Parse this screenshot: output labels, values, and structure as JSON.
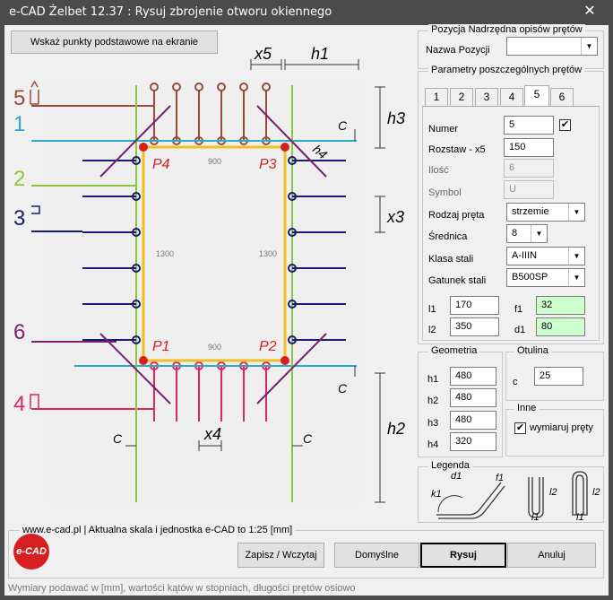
{
  "window": {
    "title": "e-CAD Żelbet 12.37 : Rysuj zbrojenie otworu okiennego",
    "close_glyph": "✕"
  },
  "toolbar": {
    "points_button": "Wskaż punkty podstawowe na ekranie"
  },
  "drawing": {
    "dim_labels": {
      "x5": "x5",
      "h1": "h1",
      "h3": "h3",
      "h4": "h4",
      "c": "C",
      "x3": "x3",
      "x4": "x4",
      "h2": "h2"
    },
    "legend_labels": {
      "b5": "5",
      "b1": "1",
      "b2": "2",
      "b3": "3",
      "b6": "6",
      "b4": "4"
    },
    "points": {
      "p1": "P1",
      "p2": "P2",
      "p3": "P3",
      "p4": "P4"
    },
    "values": {
      "width_top": "900",
      "width_bottom": "900",
      "height_left": "1300",
      "height_right": "1300"
    },
    "colors": {
      "bar5": "#9b4a3a",
      "bar1": "#27a9c9",
      "bar2": "#8cc63f",
      "bar3": "#1a1a6e",
      "bar6": "#7a1f6e",
      "bar4": "#e0245e",
      "frame": "#f0c020",
      "point": "#d62020"
    }
  },
  "parent": {
    "group_title": "Pozycja Nadrzędna opisów prętów",
    "name_label": "Nazwa Pozycji",
    "name_value": ""
  },
  "params": {
    "group_title": "Parametry poszczególnych prętów",
    "tabs": [
      "1",
      "2",
      "3",
      "4",
      "5",
      "6"
    ],
    "active_tab": "5",
    "numer_label": "Numer",
    "numer_value": "5",
    "rozstaw_label": "Rozstaw - x5",
    "rozstaw_value": "150",
    "ilosc_label": "Ilość",
    "ilosc_value": "6",
    "symbol_label": "Symbol",
    "symbol_value": "U",
    "rodzaj_label": "Rodzaj pręta",
    "rodzaj_value": "strzemie",
    "srednica_label": "Średnica",
    "srednica_value": "8",
    "klasa_label": "Klasa stali",
    "klasa_value": "A-IIIN",
    "gatunek_label": "Gatunek stali",
    "gatunek_value": "B500SP",
    "l1_label": "l1",
    "l1_value": "170",
    "l2_label": "l2",
    "l2_value": "350",
    "f1_label": "f1",
    "f1_value": "32",
    "d1_label": "d1",
    "d1_value": "80"
  },
  "geometry": {
    "group_title": "Geometria",
    "h1_label": "h1",
    "h1": "480",
    "h2_label": "h2",
    "h2": "480",
    "h3_label": "h3",
    "h3": "480",
    "h4_label": "h4",
    "h4": "320"
  },
  "otulina": {
    "group_title": "Otulina",
    "c_label": "c",
    "c": "25"
  },
  "inne": {
    "group_title": "Inne",
    "wymiaruj_label": "wymiaruj pręty",
    "wymiaruj_checked": true
  },
  "legenda": {
    "group_title": "Legenda",
    "d1": "d1",
    "f1": "f1",
    "k1": "k1",
    "l1a": "l1",
    "l2a": "l2",
    "l1b": "l1",
    "l2b": "l2"
  },
  "bottom": {
    "info": "www.e-cad.pl | Aktualna skala i jednostka e-CAD to 1:25 [mm]",
    "logo": "e-CAD",
    "save_button": "Zapisz / Wczytaj",
    "default_button": "Domyślne",
    "draw_button": "Rysuj",
    "cancel_button": "Anuluj",
    "status": "Wymiary podawać w [mm], wartości kątów w stopniach, długości prętów osiowo"
  }
}
